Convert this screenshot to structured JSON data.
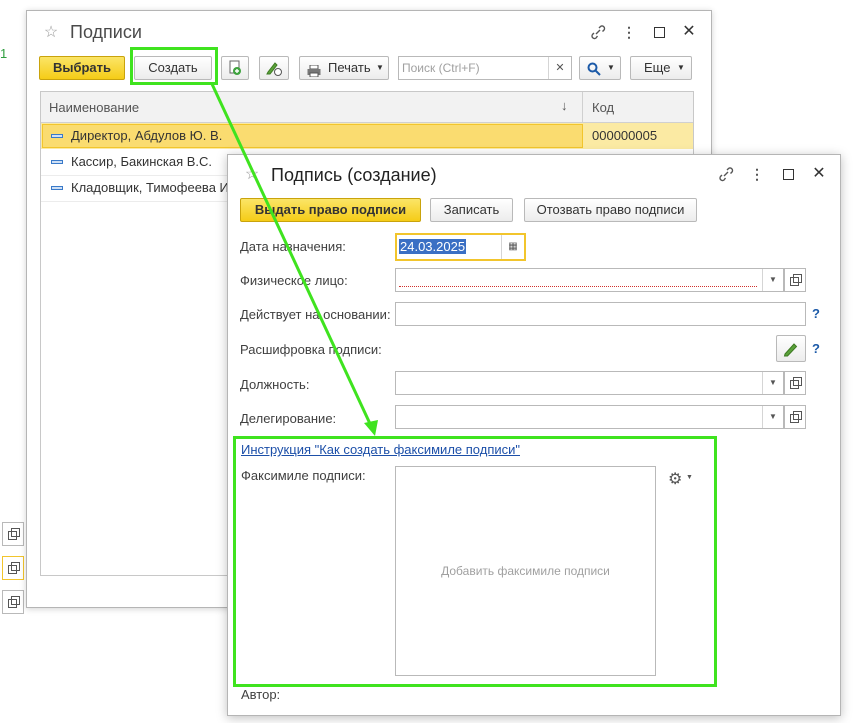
{
  "left_edge": {
    "digit": "1"
  },
  "back_window": {
    "title": "Подписи",
    "toolbar": {
      "choose_label": "Выбрать",
      "create_label": "Создать",
      "print_label": "Печать",
      "search_placeholder": "Поиск (Ctrl+F)",
      "more_label": "Еще"
    },
    "table": {
      "col_name": "Наименование",
      "col_code": "Код",
      "rows": [
        {
          "name": "Директор, Абдулов Ю. В.",
          "code": "000000005"
        },
        {
          "name": "Кассир, Бакинская В.С.",
          "code": ""
        },
        {
          "name": "Кладовщик, Тимофеева И",
          "code": ""
        }
      ]
    }
  },
  "front_window": {
    "title": "Подпись (создание)",
    "buttons": {
      "grant": "Выдать право подписи",
      "save": "Записать",
      "revoke": "Отозвать право подписи"
    },
    "fields": {
      "date_label": "Дата назначения:",
      "date_value": "24.03.2025",
      "person_label": "Физическое лицо:",
      "basis_label": "Действует на основании:",
      "decoding_label": "Расшифровка подписи:",
      "position_label": "Должность:",
      "delegation_label": "Делегирование:"
    },
    "help_mark": "?",
    "instruction_link": "Инструкция \"Как создать факсимиле подписи\"",
    "facsimile_label": "Факсимиле подписи:",
    "facsimile_placeholder": "Добавить факсимиле подписи",
    "author_label": "Автор:"
  }
}
